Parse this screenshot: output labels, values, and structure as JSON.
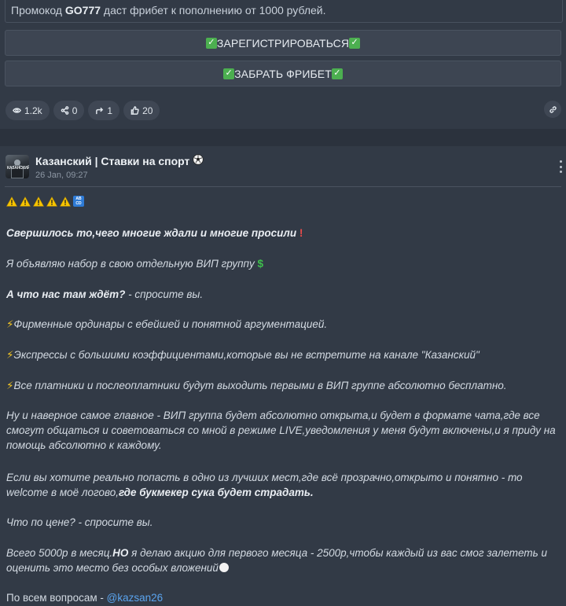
{
  "top_post": {
    "promo_prefix": "Промокод ",
    "promo_code": "GO777",
    "promo_suffix": " даст фрибет к пополнению от 1000 рублей.",
    "buttons": [
      {
        "label": "ЗАРЕГИСТРИРОВАТЬСЯ"
      },
      {
        "label": "ЗАБРАТЬ ФРИБЕТ"
      }
    ],
    "stats": {
      "views": "1.2k",
      "shares": "0",
      "forwards": "1",
      "likes": "20"
    }
  },
  "post": {
    "channel_name": "Казанский | Ставки на спорт",
    "date": "26 Jan, 09:27",
    "avatar_text": "КАЗАНСКИЙ",
    "lines": {
      "headline": "Свершилось то,чего многие ждали и многие просили",
      "announce": "Я объявляю набор в свою отдельную ВИП группу",
      "question_bold": "А что нас там ждёт?",
      "question_rest": " - спросите вы.",
      "feature1": "Фирменные ординары с ебейшей и понятной аргументацией.",
      "feature2": "Экспрессы с большими коэффициентами,которые вы не встретите на канале \"Казанский\"",
      "feature3": "Все платники и послеоплатники будут выходить первыми в ВИП группе абсолютно бесплатно.",
      "main_para": "Ну и наверное самое главное - ВИП группа будет абсолютно открыта,и будет в формате чата,где все смогут общаться и советоваться со мной в режиме LIVE,уведомления у меня будут включены,и я приду на помощь абсолютно к каждому.",
      "best_place": "Если вы хотите реально попасть в одно из лучших мест,где всё прозрачно,открыто и понятно - то welcome в моё логово,",
      "best_place_bold": "где букмекер сука будет страдать.",
      "price_q": "Что по цене? - спросите вы.",
      "price_a1": "Всего 5000р в месяц.",
      "price_a_bold": "НО",
      "price_a2": " я делаю акцию для первого месяца - 2500р,чтобы каждый из вас смог залететь и оценить это место без особых вложений",
      "contact_prefix": "По всем вопросам - ",
      "contact_handle": "@kazsan26"
    }
  }
}
